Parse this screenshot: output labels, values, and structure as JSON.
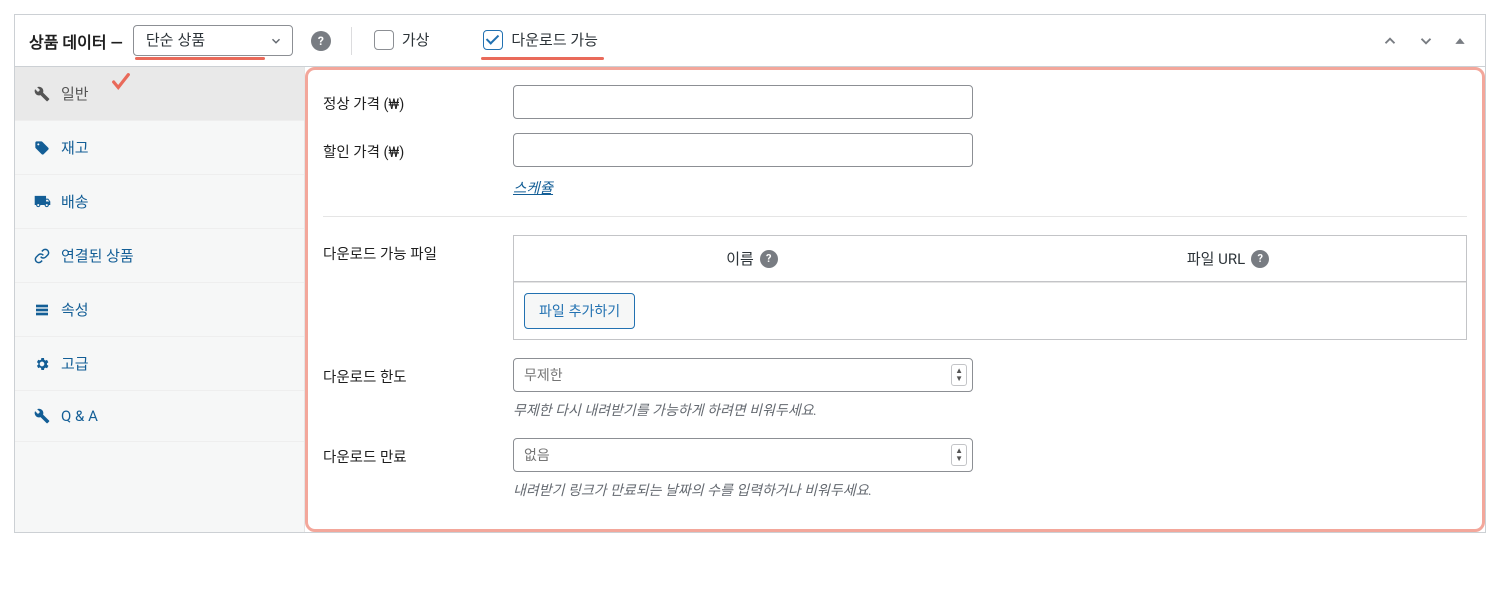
{
  "header": {
    "title": "상품 데이터 —",
    "product_type_selected": "단순 상품",
    "virtual_label": "가상",
    "downloadable_label": "다운로드 가능"
  },
  "sidebar": {
    "items": [
      {
        "id": "general",
        "label": "일반",
        "active": true
      },
      {
        "id": "inventory",
        "label": "재고",
        "active": false
      },
      {
        "id": "shipping",
        "label": "배송",
        "active": false
      },
      {
        "id": "linked",
        "label": "연결된 상품",
        "active": false
      },
      {
        "id": "attributes",
        "label": "속성",
        "active": false
      },
      {
        "id": "advanced",
        "label": "고급",
        "active": false
      },
      {
        "id": "qa",
        "label": "Q & A",
        "active": false
      }
    ]
  },
  "fields": {
    "regular_price_label": "정상 가격 (₩)",
    "sale_price_label": "할인 가격 (₩)",
    "schedule_link": "스케쥴",
    "download_files_label": "다운로드 가능 파일",
    "col_name": "이름",
    "col_url": "파일 URL",
    "add_file_btn": "파일 추가하기",
    "download_limit_label": "다운로드 한도",
    "download_limit_placeholder": "무제한",
    "download_limit_hint": "무제한 다시 내려받기를 가능하게 하려면 비워두세요.",
    "download_expiry_label": "다운로드 만료",
    "download_expiry_placeholder": "없음",
    "download_expiry_hint": "내려받기 링크가 만료되는 날짜의 수를 입력하거나 비워두세요."
  }
}
